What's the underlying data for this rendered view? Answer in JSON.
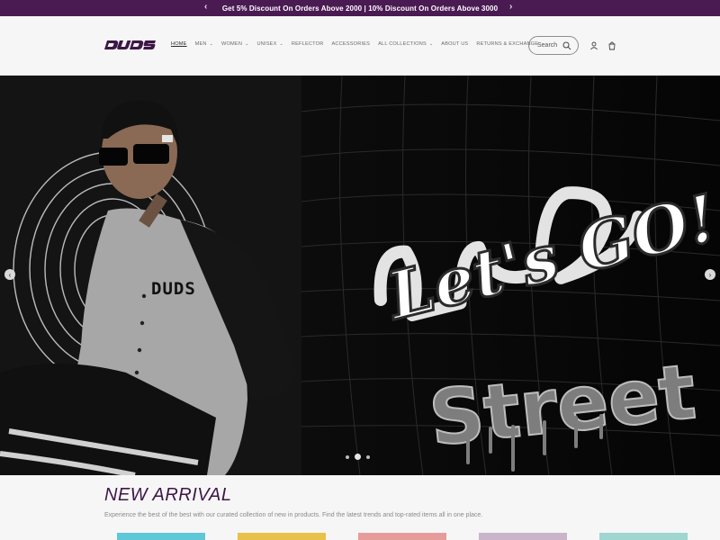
{
  "announcement": {
    "text": "Get 5% Discount On Orders Above 2000 | 10% Discount On Orders Above 3000",
    "prev_icon": "chevron-left-icon",
    "next_icon": "chevron-right-icon"
  },
  "header": {
    "logo_text": "DUDS",
    "nav": [
      {
        "label": "HOME",
        "dropdown": false,
        "active": true
      },
      {
        "label": "MEN",
        "dropdown": true
      },
      {
        "label": "WOMEN",
        "dropdown": true
      },
      {
        "label": "UNISEX",
        "dropdown": true
      },
      {
        "label": "REFLECTOR",
        "dropdown": false
      },
      {
        "label": "ACCESSORIES",
        "dropdown": false
      },
      {
        "label": "ALL COLLECTIONS",
        "dropdown": true
      },
      {
        "label": "ABOUT US",
        "dropdown": false
      },
      {
        "label": "RETURNS & EXCHANGE",
        "dropdown": false
      }
    ],
    "search_placeholder": "Search",
    "icons": [
      "search-icon",
      "account-icon",
      "cart-icon"
    ]
  },
  "hero": {
    "shirt_brand": "DUDS",
    "headline": "Let's GO!",
    "subline": "Street",
    "slides": 3,
    "active_slide": 2
  },
  "section": {
    "title": "NEW ARRIVAL",
    "subtitle": "Experience the best of the best with our curated collection of new in products. Find the latest trends and top-rated items all in one place."
  },
  "colors": {
    "brand": "#4a1a52",
    "title": "#3d1746",
    "hero_bg": "#0a0a0a"
  }
}
